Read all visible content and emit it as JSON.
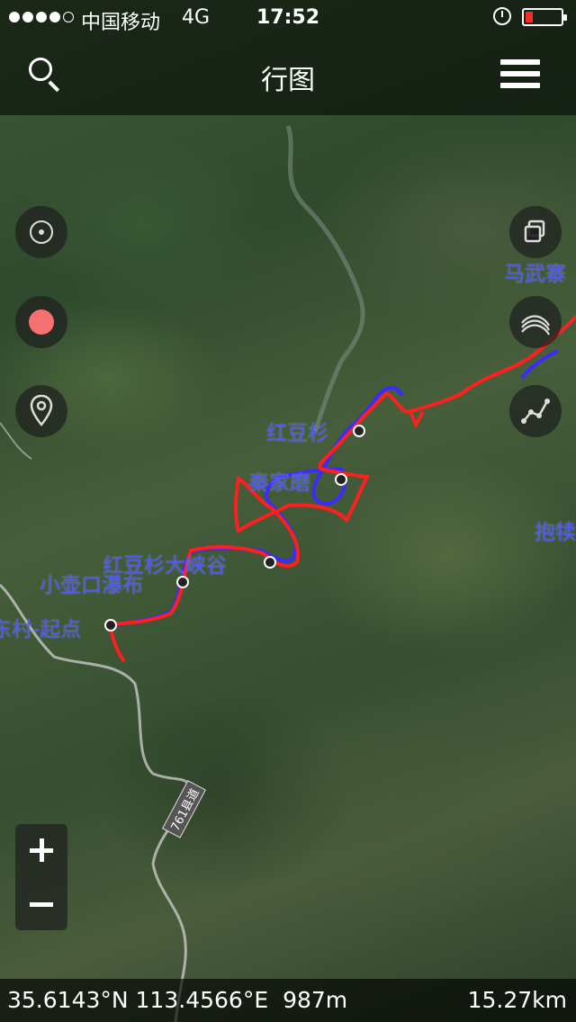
{
  "status_bar": {
    "carrier": "中国移动",
    "network": "4G",
    "time": "17:52",
    "signal_bars_filled": 4,
    "signal_bars_total": 5,
    "battery_level": 0.2,
    "battery_color": "#ff2a2a"
  },
  "nav": {
    "title": "行图"
  },
  "map": {
    "track_color": "#ff1f1f",
    "alt_track_color": "#3a2cff",
    "label_color": "#4f57ff",
    "waypoints": [
      {
        "label": "红豆杉"
      },
      {
        "label": "秦家磨"
      },
      {
        "label": "红豆杉大峡谷"
      },
      {
        "label": "小壶口瀑布"
      },
      {
        "label": "东村-起点"
      }
    ],
    "edge_labels": [
      {
        "label": "马武寨"
      },
      {
        "label": "抱犊"
      }
    ],
    "road_label": "761县道"
  },
  "controls": {
    "left": [
      "locate-icon",
      "record-icon",
      "pin-icon"
    ],
    "right": [
      "layers-icon",
      "terrain-icon",
      "track-icon"
    ],
    "zoom_in": "+",
    "zoom_out": "−"
  },
  "info": {
    "coordinates": "35.6143°N 113.4566°E",
    "altitude": "987m",
    "distance": "15.27km"
  }
}
